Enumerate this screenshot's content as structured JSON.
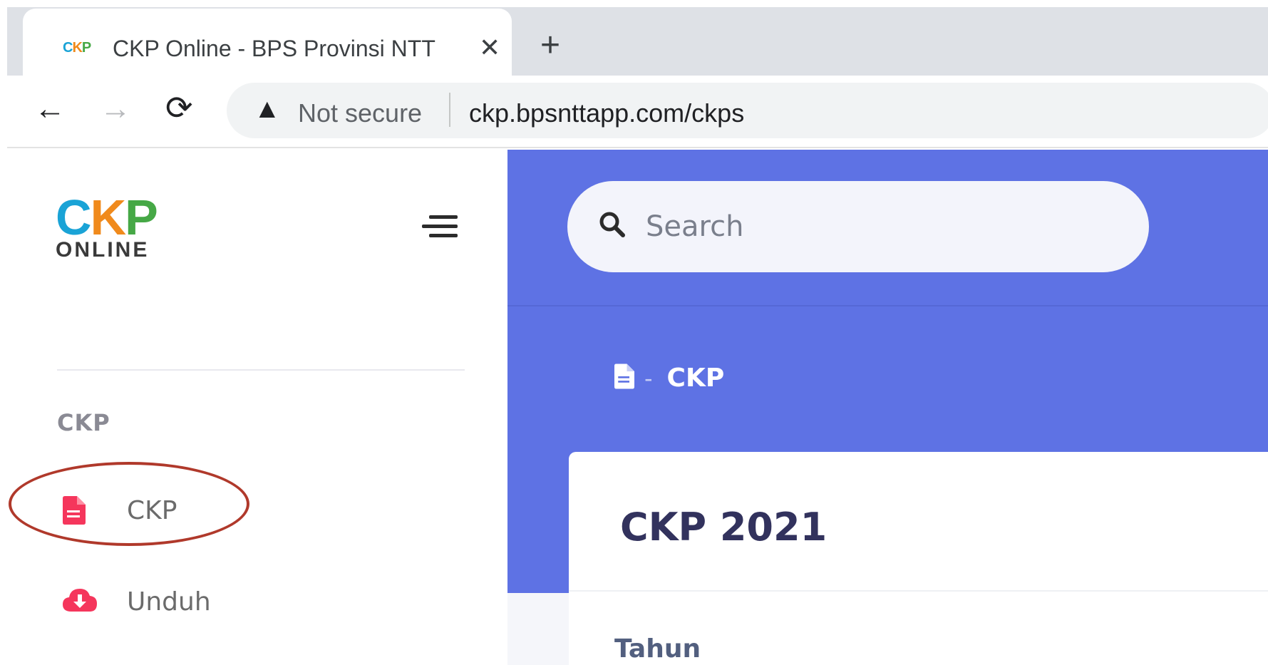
{
  "browser": {
    "tab_title": "CKP Online - BPS Provinsi NTT",
    "tab_favicon": {
      "c1": "C",
      "c2": "K",
      "c3": "P"
    },
    "tab_close": "✕",
    "new_tab": "+",
    "back": "←",
    "forward": "→",
    "reload": "⟳",
    "security_warning": "Not secure",
    "url": "ckp.bpsnttapp.com/ckps"
  },
  "sidebar": {
    "logo": {
      "c1": "C",
      "c2": "K",
      "c3": "P",
      "subtitle": "ONLINE"
    },
    "section_heading": "CKP",
    "items": [
      {
        "label": "CKP",
        "icon": "file-icon",
        "color": "#f5365c"
      },
      {
        "label": "Unduh",
        "icon": "cloud-download-icon",
        "color": "#f5365c"
      }
    ]
  },
  "header": {
    "search_placeholder": "Search",
    "breadcrumb": {
      "separator": "-",
      "current": "CKP"
    }
  },
  "card": {
    "title": "CKP 2021",
    "field_label": "Tahun"
  },
  "colors": {
    "primary": "#5e72e4",
    "danger": "#f5365c",
    "annotation": "#b0392b"
  }
}
